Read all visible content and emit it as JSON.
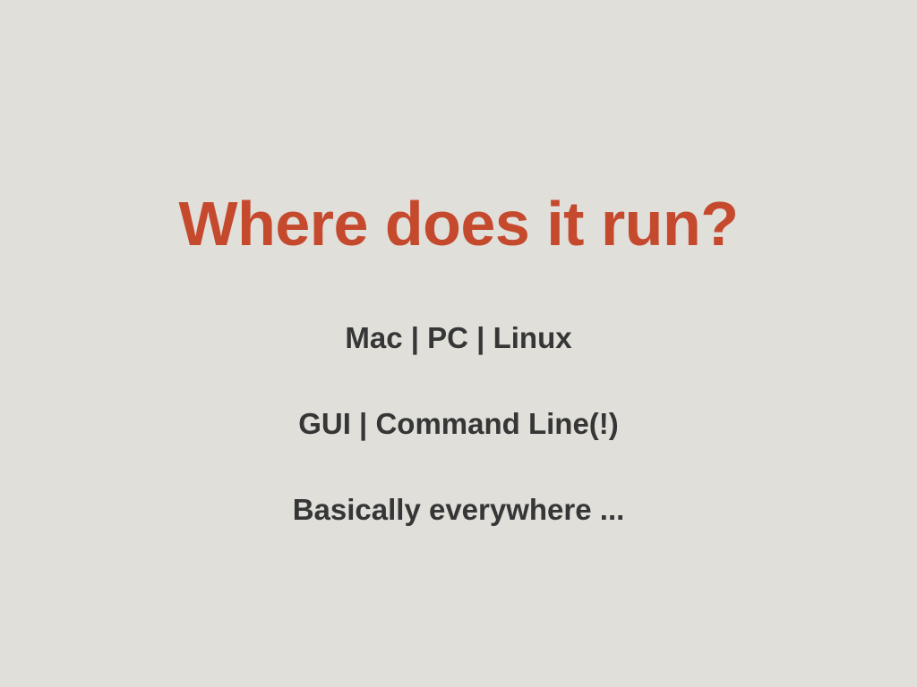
{
  "slide": {
    "title": "Where does it run?",
    "bullets": [
      "Mac | PC | Linux",
      "GUI | Command Line(!)",
      "Basically everywhere ..."
    ]
  },
  "colors": {
    "background": "#e0dfda",
    "title": "#c5492d",
    "body_text": "#363636"
  }
}
